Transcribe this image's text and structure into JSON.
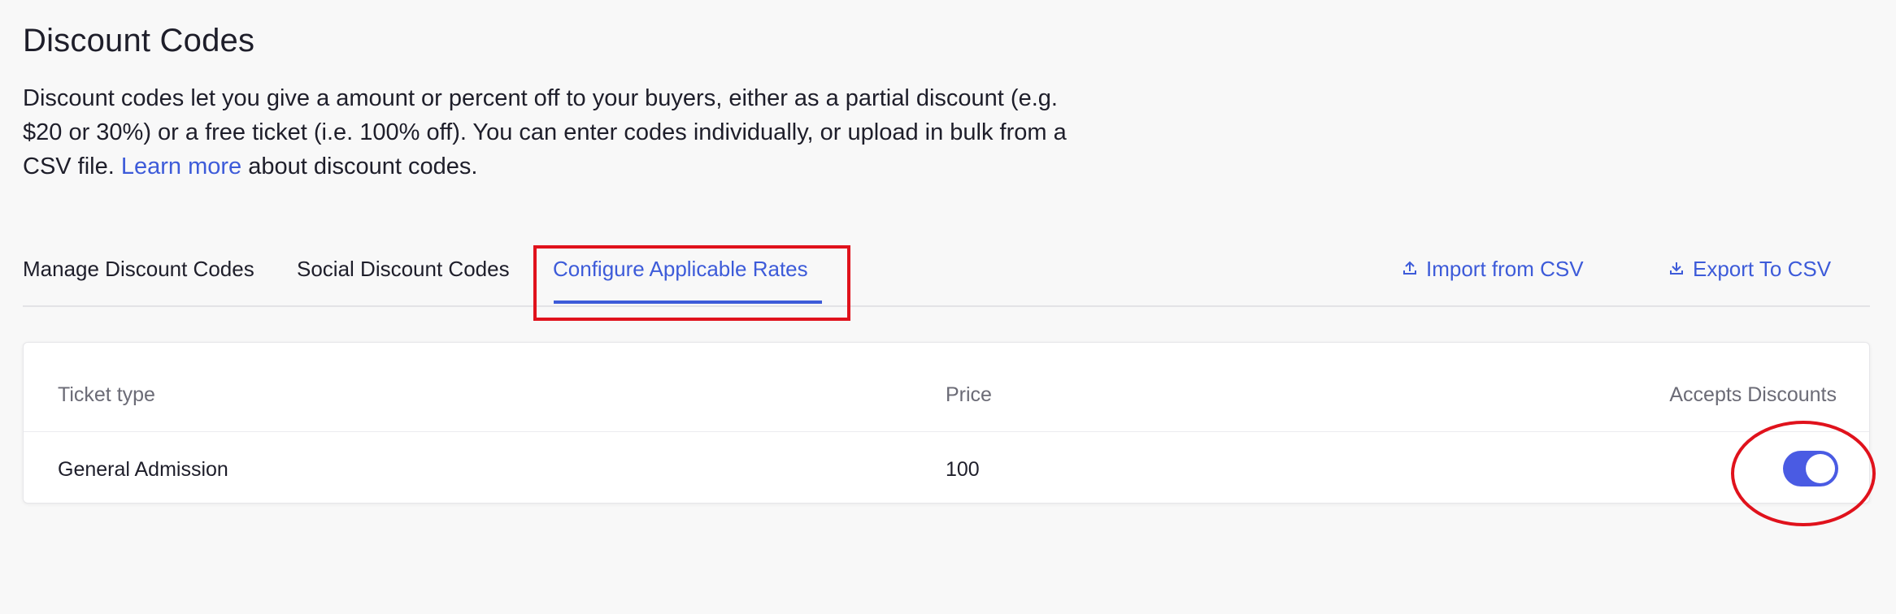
{
  "header": {
    "title": "Discount Codes",
    "description_text": "Discount codes let you give a amount or percent off to your buyers, either as a partial discount (e.g. $20 or 30%) or a free ticket (i.e. 100% off). You can enter codes individually, or upload in bulk from a CSV file.",
    "learn_more_link": "Learn more",
    "description_suffix": "about discount codes."
  },
  "tabs": [
    {
      "label": "Manage Discount Codes",
      "active": false
    },
    {
      "label": "Social Discount Codes",
      "active": false
    },
    {
      "label": "Configure Applicable Rates",
      "active": true
    }
  ],
  "actions": {
    "import_label": "Import from CSV",
    "export_label": "Export To CSV"
  },
  "table": {
    "columns": [
      "Ticket type",
      "Price",
      "Accepts Discounts"
    ],
    "rows": [
      {
        "ticket_type": "General Admission",
        "price": "100",
        "accepts_discounts": true
      }
    ]
  },
  "colors": {
    "accent": "#3d5bd9",
    "toggle_on": "#4a5be3",
    "annotation_red": "#e0121c"
  }
}
